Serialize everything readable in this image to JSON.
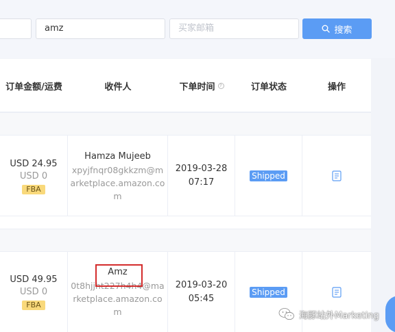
{
  "search": {
    "keyword_value": "amz",
    "email_placeholder": "买家邮箱",
    "button_label": "搜索"
  },
  "table": {
    "columns": {
      "amount": "订单金额/运费",
      "recipient": "收件人",
      "order_time": "下单时间",
      "status": "订单状态",
      "actions": "操作"
    },
    "rows": [
      {
        "amount": "USD 24.95",
        "shipping": "USD 0",
        "fulfillment": "FBA",
        "recipient_name": "Hamza Mujeeb",
        "recipient_email": "xpyjfnqr08gkkzm@marketplace.amazon.com",
        "date": "2019-03-28",
        "time": "07:17",
        "status": "Shipped"
      },
      {
        "amount": "USD 49.95",
        "shipping": "USD 0",
        "fulfillment": "FBA",
        "recipient_name": "Amz",
        "recipient_email": "0t8hjjht227h4h4@marketplace.amazon.com",
        "date": "2019-03-20",
        "time": "05:45",
        "status": "Shipped"
      }
    ]
  },
  "watermark": {
    "text": "海豚站外Marketing",
    "icon": "wechat-icon"
  },
  "colors": {
    "primary": "#5b9cf4",
    "fba_badge": "#f9d97b",
    "highlight": "#d32b2b"
  }
}
